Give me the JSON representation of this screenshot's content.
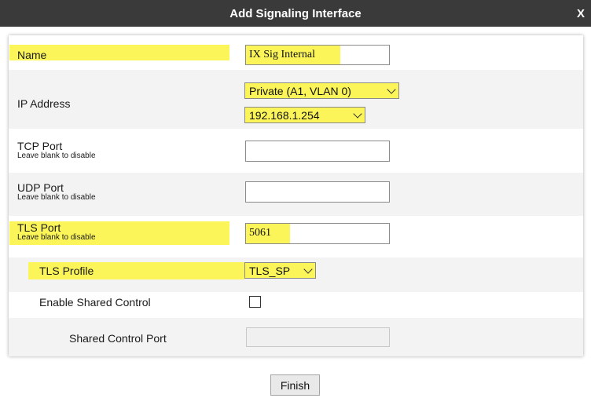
{
  "dialog": {
    "title": "Add Signaling Interface",
    "close_label": "X"
  },
  "fields": {
    "name": {
      "label": "Name",
      "value": "IX Sig Internal"
    },
    "ip_address": {
      "label": "IP Address",
      "interface_value": "Private (A1, VLAN 0)",
      "address_value": "192.168.1.254"
    },
    "tcp_port": {
      "label": "TCP Port",
      "hint": "Leave blank to disable",
      "value": ""
    },
    "udp_port": {
      "label": "UDP Port",
      "hint": "Leave blank to disable",
      "value": ""
    },
    "tls_port": {
      "label": "TLS Port",
      "hint": "Leave blank to disable",
      "value": "5061"
    },
    "tls_profile": {
      "label": "TLS Profile",
      "value": "TLS_SP"
    },
    "enable_shared_control": {
      "label": "Enable Shared Control",
      "checked": false
    },
    "shared_control_port": {
      "label": "Shared Control Port",
      "value": ""
    }
  },
  "finish_button": {
    "label": "Finish"
  },
  "colors": {
    "titlebar": "#3a3a3a",
    "highlight": "#fbf55a",
    "row_alt": "#f3f3f3"
  }
}
